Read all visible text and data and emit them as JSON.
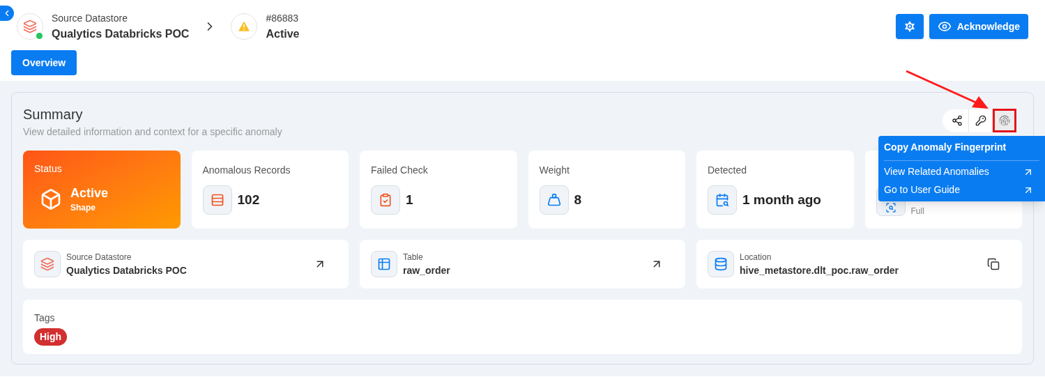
{
  "breadcrumb": {
    "datastore_label": "Source Datastore",
    "datastore_name": "Qualytics Databricks POC",
    "datastore_online": true,
    "anomaly_id": "#86883",
    "anomaly_status": "Active"
  },
  "header_actions": [
    {
      "kind": "settings"
    },
    {
      "kind": "acknowledge",
      "label": "Acknowledge"
    }
  ],
  "tabs": [
    {
      "label": "Overview",
      "selected": true
    }
  ],
  "summary": {
    "title": "Summary",
    "subtitle": "View detailed information and context for a specific anomaly",
    "actions": [
      {
        "kind": "share",
        "highlighted": false
      },
      {
        "kind": "key",
        "highlighted": false
      },
      {
        "kind": "fingerprint",
        "highlighted": true
      }
    ],
    "menu": {
      "items": [
        {
          "label": "Copy Anomaly Fingerprint",
          "kind": "title"
        },
        {
          "label": "View Related Anomalies",
          "kind": "link"
        },
        {
          "label": "Go to User Guide",
          "kind": "link"
        }
      ]
    },
    "stats": [
      {
        "kind": "status",
        "label": "Status",
        "value": "Active",
        "sub": "Shape"
      },
      {
        "kind": "records",
        "label": "Anomalous Records",
        "value": "102"
      },
      {
        "kind": "check",
        "label": "Failed Check",
        "value": "1"
      },
      {
        "kind": "weight",
        "label": "Weight",
        "value": "8"
      },
      {
        "kind": "detected",
        "label": "Detected",
        "value": "1 month ago"
      },
      {
        "kind": "scan",
        "sub": "Full"
      }
    ],
    "details": [
      {
        "kind": "datastore",
        "label": "Source Datastore",
        "value": "Qualytics Databricks POC",
        "linked": true,
        "copyable": false
      },
      {
        "kind": "table",
        "label": "Table",
        "value": "raw_order",
        "linked": true,
        "copyable": false
      },
      {
        "kind": "location",
        "label": "Location",
        "value": "hive_metastore.dlt_poc.raw_order",
        "linked": false,
        "copyable": true
      }
    ],
    "tags": {
      "label": "Tags",
      "items": [
        {
          "label": "High",
          "color": "#d32f2f"
        }
      ]
    }
  }
}
